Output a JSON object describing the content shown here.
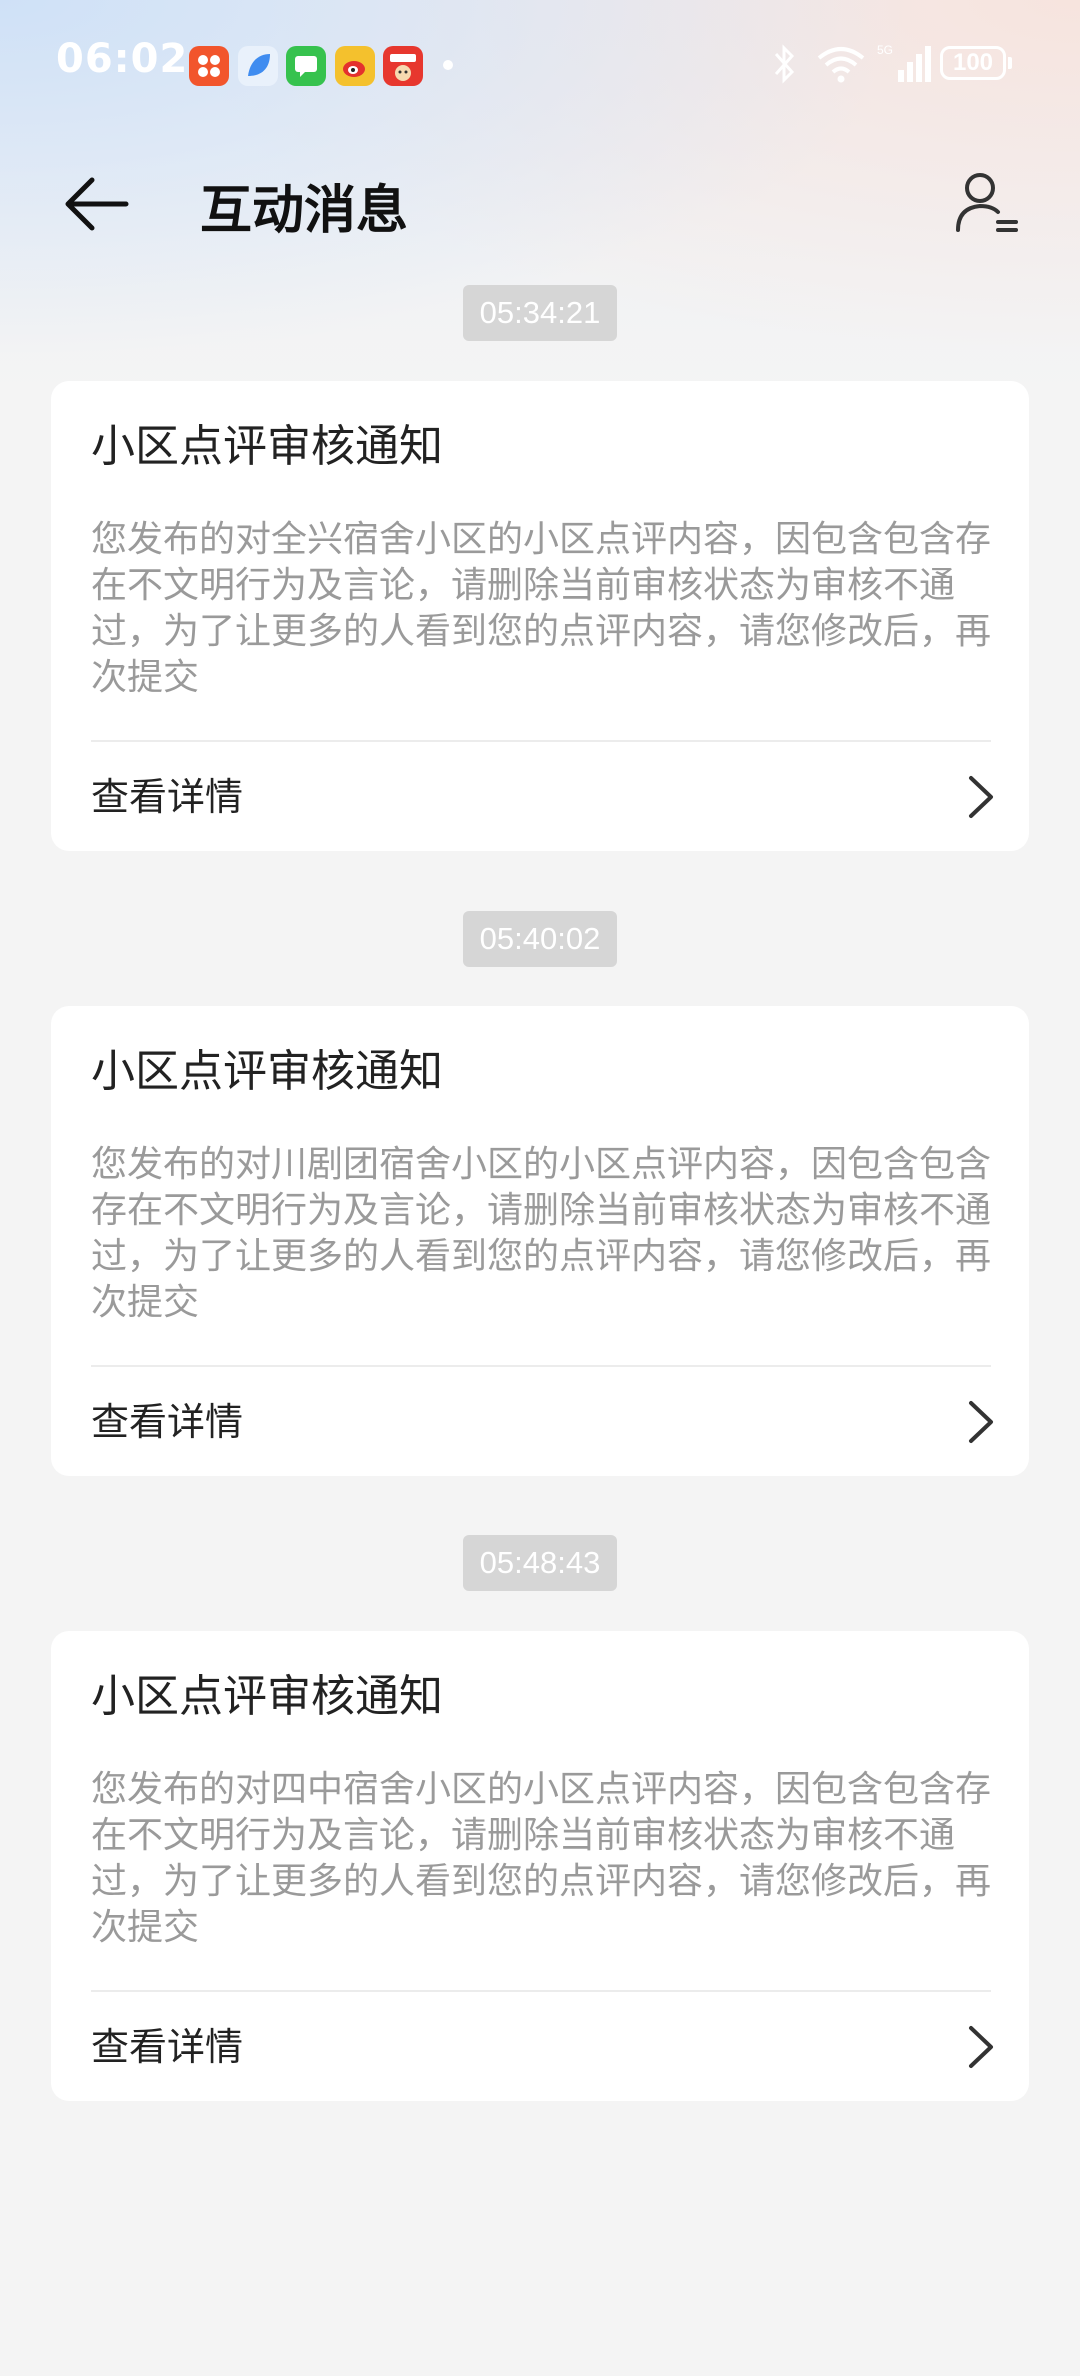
{
  "status_bar": {
    "time": "06:02",
    "app_icons": [
      {
        "name": "app-icon-orange",
        "color": "#f2552c"
      },
      {
        "name": "app-icon-blue-leaf",
        "color": "#3f8cf0"
      },
      {
        "name": "app-icon-green-chat",
        "color": "#36c24e"
      },
      {
        "name": "app-icon-weibo",
        "color": "#f4c12d"
      },
      {
        "name": "app-icon-takeout",
        "color": "#e7372e"
      }
    ],
    "network_label": "5G",
    "battery": "100"
  },
  "header": {
    "title": "互动消息"
  },
  "messages": [
    {
      "time": "05:34:21",
      "title": "小区点评审核通知",
      "body": "您发布的对全兴宿舍小区的小区点评内容，因包含包含存在不文明行为及言论，请删除当前审核状态为审核不通过，为了让更多的人看到您的点评内容，请您修改后，再次提交",
      "link_label": "查看详情"
    },
    {
      "time": "05:40:02",
      "title": "小区点评审核通知",
      "body": "您发布的对川剧团宿舍小区的小区点评内容，因包含包含存在不文明行为及言论，请删除当前审核状态为审核不通过，为了让更多的人看到您的点评内容，请您修改后，再次提交",
      "link_label": "查看详情"
    },
    {
      "time": "05:48:43",
      "title": "小区点评审核通知",
      "body": "您发布的对四中宿舍小区的小区点评内容，因包含包含存在不文明行为及言论，请删除当前审核状态为审核不通过，为了让更多的人看到您的点评内容，请您修改后，再次提交",
      "link_label": "查看详情"
    }
  ]
}
